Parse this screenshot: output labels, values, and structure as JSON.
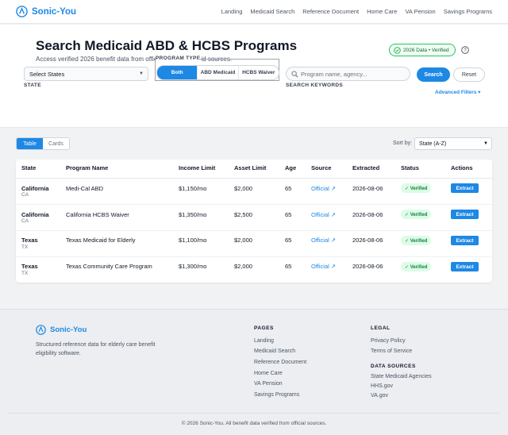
{
  "brand": {
    "name": "Sonic-You",
    "color": "#1e88e5"
  },
  "nav": [
    "Landing",
    "Medicaid Search",
    "Reference Document",
    "Home Care",
    "VA Pension",
    "Savings Programs"
  ],
  "hero": {
    "title": "Search Medicaid ABD & HCBS Programs",
    "subtitle": "Access verified 2026 benefit data from official state Medicaid sources.",
    "badge": "2026 Data • Verified"
  },
  "filters": {
    "state_label": "STATE",
    "state_value": "Select States",
    "program_type_label": "PROGRAM TYPE",
    "program_types": [
      "Both",
      "ABD Medicaid",
      "HCBS Waiver"
    ],
    "program_type_selected": "Both",
    "keywords_label": "SEARCH KEYWORDS",
    "keywords_placeholder": "Program name, agency...",
    "search_button": "Search",
    "reset_button": "Reset",
    "advanced": "Advanced Filters ▾"
  },
  "results": {
    "views": [
      "Table",
      "Cards"
    ],
    "view_selected": "Table",
    "sort_label": "Sort by:",
    "sort_value": "State (A-Z)",
    "columns": [
      "State",
      "Program Name",
      "Income Limit",
      "Asset Limit",
      "Age",
      "Source",
      "Extracted",
      "Status",
      "Actions"
    ],
    "rows": [
      {
        "state": "California",
        "abbr": "CA",
        "program": "Medi-Cal ABD",
        "income": "$1,150/mo",
        "asset": "$2,000",
        "age": "65",
        "source": "Official ↗",
        "extracted": "2026-08-06",
        "status": "✓ Verified",
        "action": "Extract"
      },
      {
        "state": "California",
        "abbr": "CA",
        "program": "California HCBS Waiver",
        "income": "$1,350/mo",
        "asset": "$2,500",
        "age": "65",
        "source": "Official ↗",
        "extracted": "2026-08-06",
        "status": "✓ Verified",
        "action": "Extract"
      },
      {
        "state": "Texas",
        "abbr": "TX",
        "program": "Texas Medicaid for Elderly",
        "income": "$1,100/mo",
        "asset": "$2,000",
        "age": "65",
        "source": "Official ↗",
        "extracted": "2026-08-06",
        "status": "✓ Verified",
        "action": "Extract"
      },
      {
        "state": "Texas",
        "abbr": "TX",
        "program": "Texas Community Care Program",
        "income": "$1,300/mo",
        "asset": "$2,000",
        "age": "65",
        "source": "Official ↗",
        "extracted": "2026-08-06",
        "status": "✓ Verified",
        "action": "Extract"
      }
    ]
  },
  "footer": {
    "brand": "Sonic-You",
    "description": "Structured reference data for elderly care benefit eligibility software.",
    "pages_heading": "PAGES",
    "pages": [
      "Landing",
      "Medicaid Search",
      "Reference Document",
      "Home Care",
      "VA Pension",
      "Savings Programs"
    ],
    "legal_heading": "LEGAL",
    "legal": [
      "Privacy Policy",
      "Terms of Service"
    ],
    "sources_heading": "DATA SOURCES",
    "sources": [
      "State Medicaid Agencies",
      "HHS.gov",
      "VA.gov"
    ],
    "copyright": "© 2026 Sonic-You. All benefit data verified from official sources."
  }
}
